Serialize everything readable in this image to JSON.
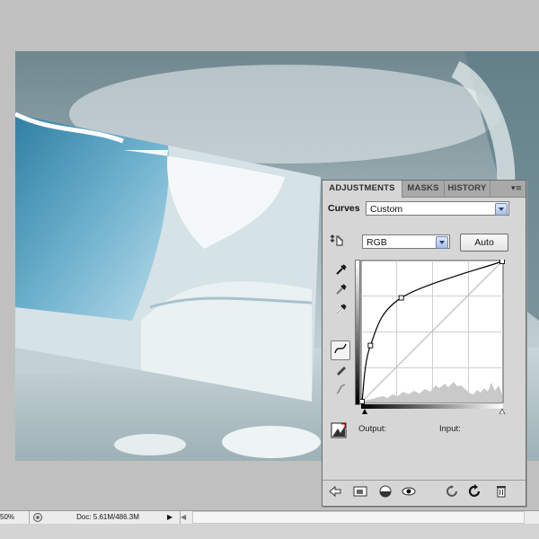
{
  "panel": {
    "tabs": [
      "ADJUSTMENTS",
      "MASKS",
      "HISTORY"
    ],
    "adjustment_label": "Curves",
    "preset": "Custom",
    "channel": "RGB",
    "auto_label": "Auto",
    "output_label": "Output:",
    "input_label": "Input:"
  },
  "status_bar": {
    "zoom": "50%",
    "doc_info": "Doc: 5.61M/486.3M"
  },
  "icons": {
    "panel_menu": "panel-menu-icon",
    "targeted_adjustment": "hand-target-icon",
    "eyedroppers": [
      "black-point-eyedropper-icon",
      "gray-point-eyedropper-icon",
      "white-point-eyedropper-icon"
    ],
    "curve_tools": [
      "curve-point-tool-icon",
      "pencil-tool-icon",
      "smooth-curve-icon"
    ],
    "clipping_warning": "clipping-warning-icon",
    "footer": [
      "back-arrow-icon",
      "expand-view-icon",
      "clip-to-layer-icon",
      "visibility-eye-icon",
      "previous-state-icon",
      "reset-icon",
      "trash-icon"
    ]
  },
  "curve": {
    "points": [
      [
        0,
        0
      ],
      [
        6,
        40
      ],
      [
        28,
        74
      ],
      [
        100,
        100
      ]
    ]
  },
  "colors": {
    "panel_bg": "#d6d6d6",
    "workspace_bg": "#c0c0c0",
    "dropdown_arrow": "#a8bde0"
  }
}
